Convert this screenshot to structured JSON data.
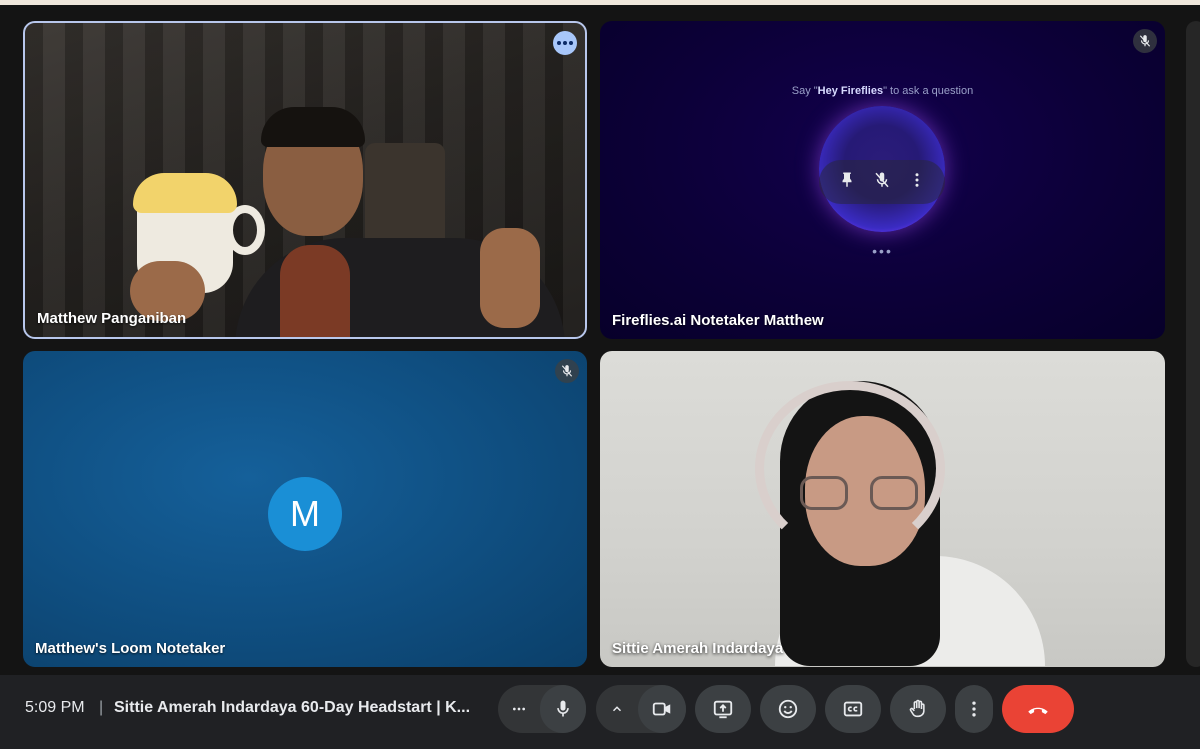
{
  "participants": [
    {
      "name": "Matthew Panganiban"
    },
    {
      "name": "Fireflies.ai Notetaker Matthew",
      "prompt_pre": "Say \"",
      "prompt_bold": "Hey Fireflies",
      "prompt_post": "\" to ask a question"
    },
    {
      "name": "Matthew's Loom Notetaker",
      "avatar_letter": "M"
    },
    {
      "name": "Sittie Amerah Indardaya"
    }
  ],
  "bottom_bar": {
    "time": "5:09 PM",
    "separator": "|",
    "meeting_title": "Sittie Amerah Indardaya 60-Day Headstart | K..."
  },
  "colors": {
    "hangup": "#ea4335",
    "active_speaker_border": "#b8c7ec",
    "avatar": "#1a8fd6"
  },
  "icons": [
    "more-options-icon",
    "mic-off-icon",
    "pin-icon",
    "microphone-icon",
    "chevron-up-icon",
    "camera-icon",
    "present-screen-icon",
    "emoji-icon",
    "captions-icon",
    "raise-hand-icon",
    "vertical-dots-icon",
    "hang-up-icon"
  ]
}
